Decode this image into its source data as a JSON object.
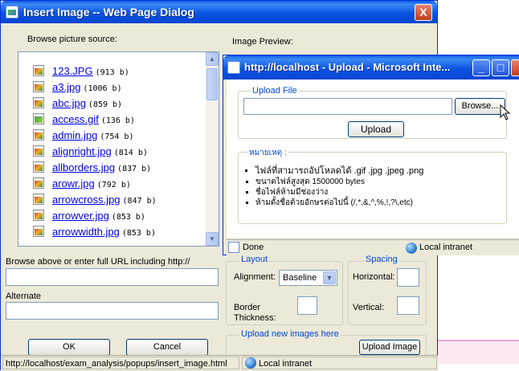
{
  "dialog": {
    "title": "Insert Image -- Web Page Dialog",
    "close_glyph": "X",
    "browse_label": "Browse picture source:",
    "preview_label": "Image Preview:",
    "files": [
      {
        "name": "123.JPG",
        "size": "(913 b)",
        "icon": "jpg-file-icon"
      },
      {
        "name": "a3.jpg",
        "size": "(1006 b)",
        "icon": "jpg-file-icon"
      },
      {
        "name": "abc.jpg",
        "size": "(859 b)",
        "icon": "jpg-file-icon"
      },
      {
        "name": "access.gif",
        "size": "(136 b)",
        "icon": "gif-file-icon"
      },
      {
        "name": "admin.jpg",
        "size": "(754 b)",
        "icon": "jpg-file-icon"
      },
      {
        "name": "alignright.jpg",
        "size": "(814 b)",
        "icon": "jpg-file-icon"
      },
      {
        "name": "allborders.jpg",
        "size": "(837 b)",
        "icon": "jpg-file-icon"
      },
      {
        "name": "arowr.jpg",
        "size": "(792 b)",
        "icon": "jpg-file-icon"
      },
      {
        "name": "arrowcross.jpg",
        "size": "(847 b)",
        "icon": "jpg-file-icon"
      },
      {
        "name": "arrowver.jpg",
        "size": "(853 b)",
        "icon": "jpg-file-icon"
      },
      {
        "name": "arrowwidth.jpg",
        "size": "(853 b)",
        "icon": "jpg-file-icon"
      }
    ],
    "url_label": "Browse above or enter full URL including http://",
    "url_value": "",
    "alternate_label": "Alternate",
    "alternate_value": "",
    "layout_legend": "Layout",
    "spacing_legend": "Spacing",
    "alignment_label": "Alignment:",
    "alignment_value": "Baseline",
    "border_label_line1": "Border",
    "border_label_line2": "Thickness:",
    "horizontal_label": "Horizontal:",
    "vertical_label": "Vertical:",
    "upload_legend": "Upload new images here",
    "upload_image_button": "Upload Image",
    "ok_button": "OK",
    "cancel_button": "Cancel",
    "status_url": "http://localhost/exam_analysis/popups/insert_image.html",
    "status_zone": "Local intranet"
  },
  "popup": {
    "title": "http://localhost - Upload - Microsoft Inte...",
    "min_glyph": "_",
    "max_glyph": "□",
    "close_glyph": "X",
    "upload_file_legend": "Upload File",
    "browse_button": "Browse...",
    "upload_button": "Upload",
    "notes_heading": "หมายเหตุ :",
    "notes": [
      "ไฟล์ที่สามารถอัปโหลดได้  .gif  .jpg  .jpeg  .png",
      "ขนาดไฟล์สูงสุด 1500000 bytes",
      "ชื่อไฟล์ห้ามมีช่องว่าง",
      "ห้ามตั้งชื่อด้วยอักษรต่อไปนี้ (/,*,&,^,%,!,?\\,etc)"
    ],
    "status_done": "Done",
    "status_zone": "Local intranet"
  },
  "colors": {
    "title_blue": "#0a54e2",
    "dialog_bg": "#ece9d8",
    "link_blue": "#0000ee",
    "legend_blue": "#0046d5"
  }
}
